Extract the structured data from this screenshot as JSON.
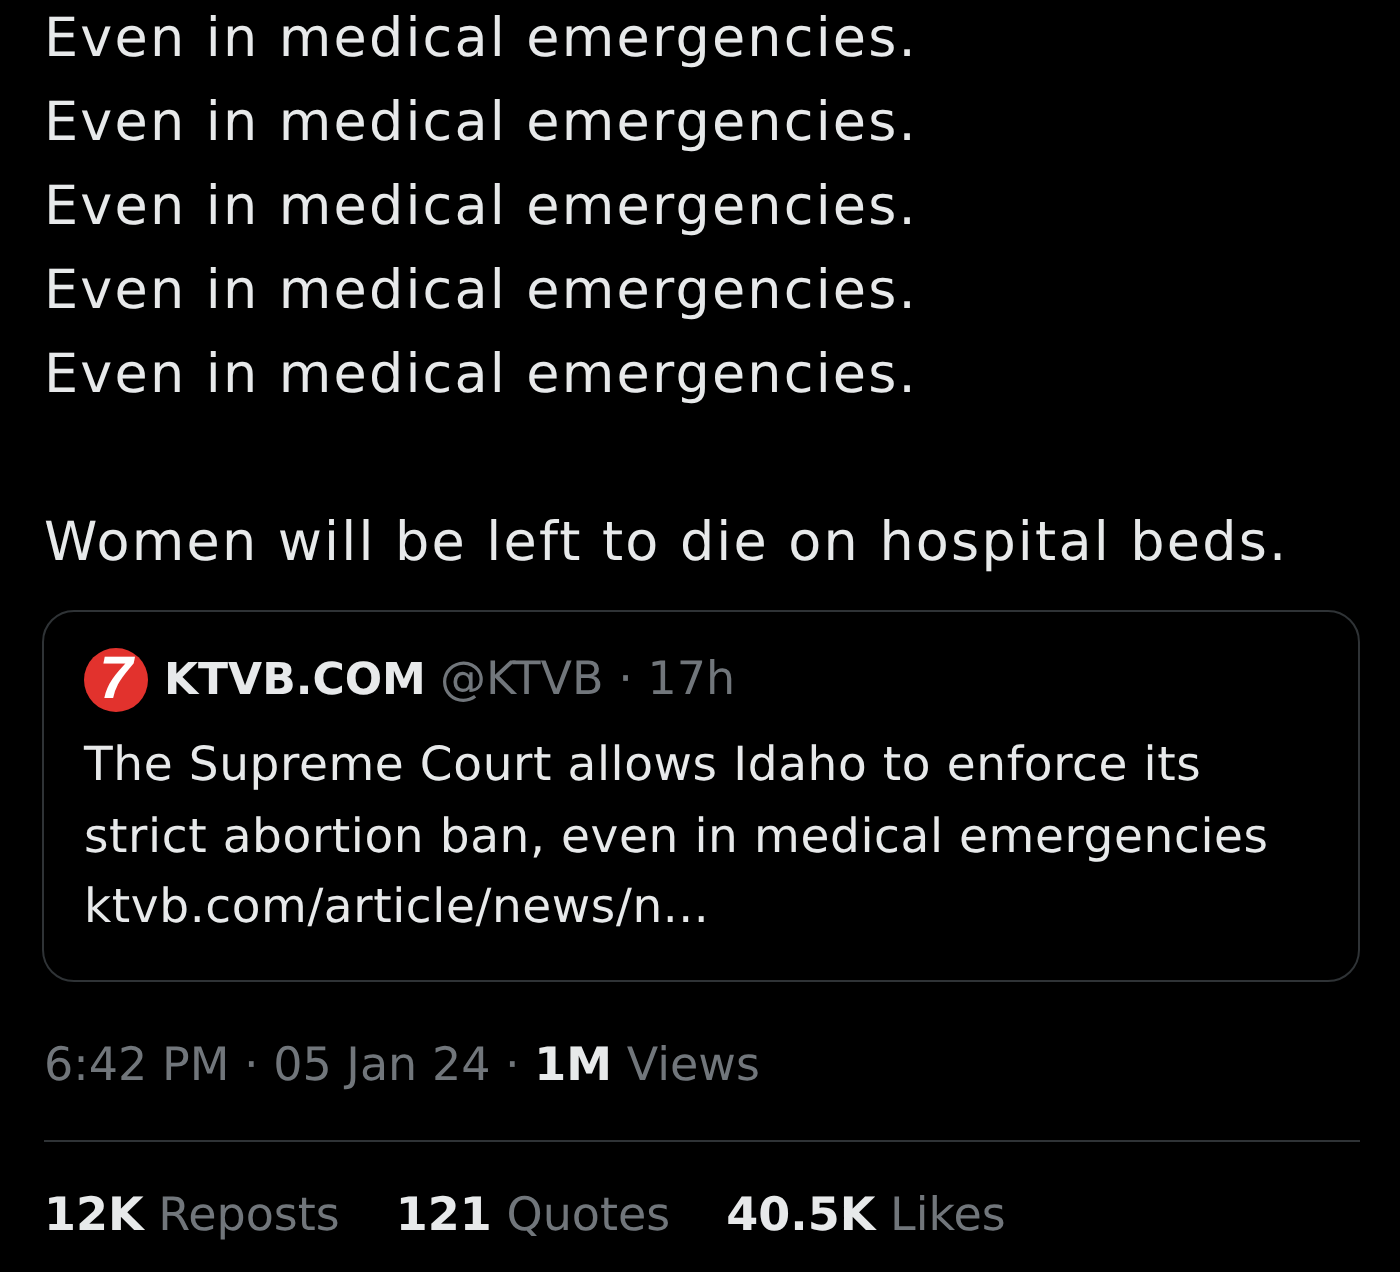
{
  "post": {
    "paragraphs": [
      "Even in medical emergencies.\nEven in medical emergencies.\nEven in medical emergencies.\nEven in medical emergencies.\nEven in medical emergencies.",
      "Women will be left to die on hospital beds."
    ]
  },
  "quoted_post": {
    "logo_text": "7",
    "name": "KTVB.COM",
    "handle_time": "@KTVB · 17h",
    "text": "The Supreme Court allows Idaho to enforce its strict abortion ban, even in medical emergencies",
    "link": "ktvb.com/article/news/n..."
  },
  "meta": "6:42 PM · 05 Jan 24 · **1M** Views",
  "stats": [
    {
      "count": "12K",
      "label": "Reposts"
    },
    {
      "count": "121",
      "label": "Quotes"
    },
    {
      "count": "40.5K",
      "label": "Likes"
    }
  ]
}
